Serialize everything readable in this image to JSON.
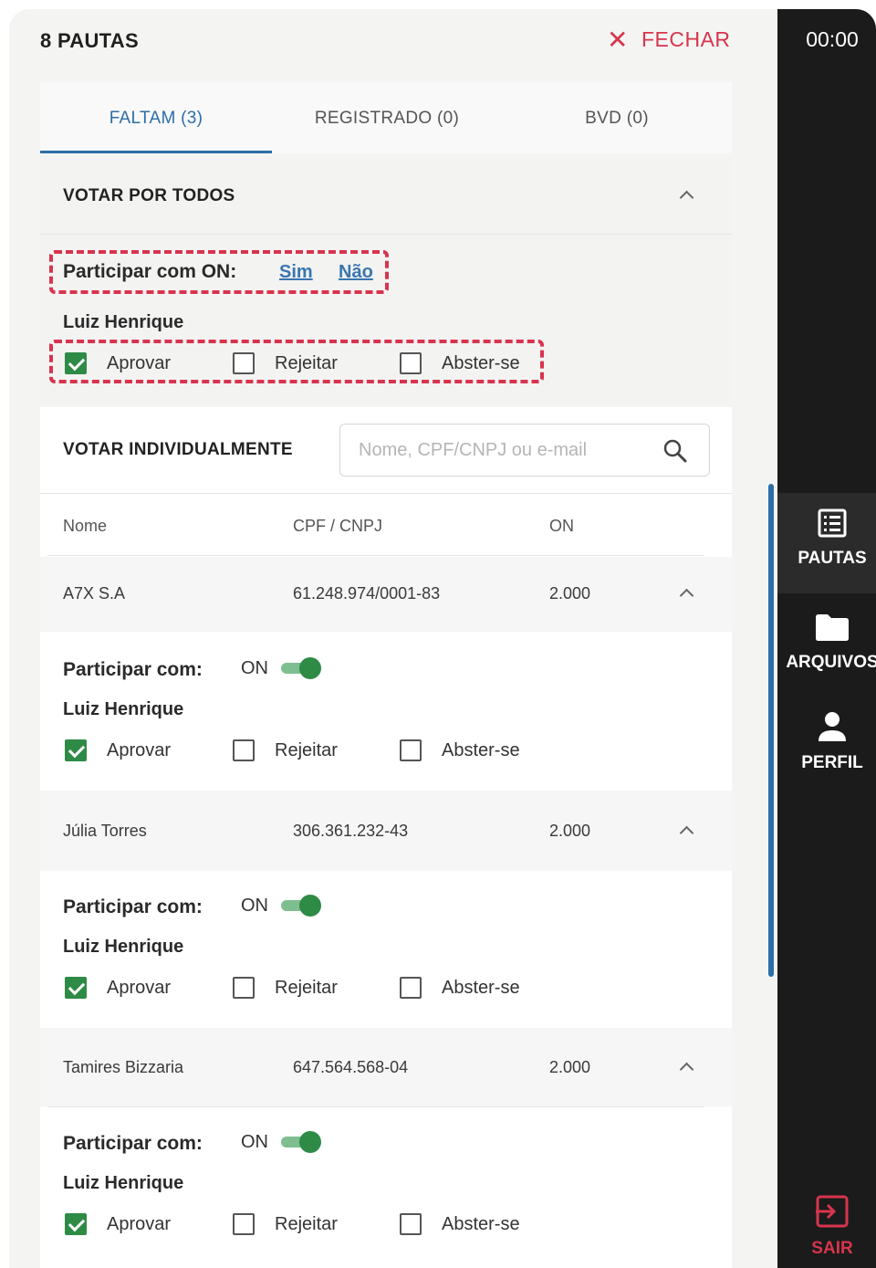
{
  "header": {
    "title": "8 PAUTAS",
    "close_label": "FECHAR"
  },
  "tabs": [
    {
      "label": "FALTAM (3)",
      "active": true
    },
    {
      "label": "REGISTRADO (0)",
      "active": false
    },
    {
      "label": "BVD (0)",
      "active": false
    }
  ],
  "votar_todos": {
    "title": "VOTAR POR TODOS",
    "participar_label": "Participar com ON:",
    "sim": "Sim",
    "nao": "Não",
    "person": "Luiz Henrique",
    "options": [
      {
        "label": "Aprovar",
        "checked": true
      },
      {
        "label": "Rejeitar",
        "checked": false
      },
      {
        "label": "Abster-se",
        "checked": false
      }
    ]
  },
  "votar_individual": {
    "title": "VOTAR INDIVIDUALMENTE",
    "search_placeholder": "Nome, CPF/CNPJ ou e-mail",
    "columns": [
      "Nome",
      "CPF / CNPJ",
      "ON"
    ],
    "participar_label": "Participar com:",
    "toggle_label": "ON",
    "rows": [
      {
        "nome": "A7X S.A",
        "doc": "61.248.974/0001-83",
        "on": "2.000",
        "person": "Luiz Henrique",
        "options": [
          {
            "label": "Aprovar",
            "checked": true
          },
          {
            "label": "Rejeitar",
            "checked": false
          },
          {
            "label": "Abster-se",
            "checked": false
          }
        ]
      },
      {
        "nome": "Júlia Torres",
        "doc": "306.361.232-43",
        "on": "2.000",
        "person": "Luiz Henrique",
        "options": [
          {
            "label": "Aprovar",
            "checked": true
          },
          {
            "label": "Rejeitar",
            "checked": false
          },
          {
            "label": "Abster-se",
            "checked": false
          }
        ]
      },
      {
        "nome": "Tamires Bizzaria",
        "doc": "647.564.568-04",
        "on": "2.000",
        "person": "Luiz Henrique",
        "options": [
          {
            "label": "Aprovar",
            "checked": true
          },
          {
            "label": "Rejeitar",
            "checked": false
          },
          {
            "label": "Abster-se",
            "checked": false
          }
        ]
      }
    ]
  },
  "sidebar": {
    "timer": "00:00",
    "items": [
      {
        "label": "PAUTAS",
        "icon": "list-icon",
        "active": true
      },
      {
        "label": "ARQUIVOS",
        "icon": "folder-icon",
        "active": false
      },
      {
        "label": "PERFIL",
        "icon": "user-icon",
        "active": false
      }
    ],
    "logout": {
      "label": "SAIR",
      "icon": "logout-icon"
    }
  },
  "colors": {
    "accent": "#2d6ea8",
    "danger": "#d8344d",
    "success": "#2e8b46",
    "sidebar_bg": "#1b1b1b"
  }
}
